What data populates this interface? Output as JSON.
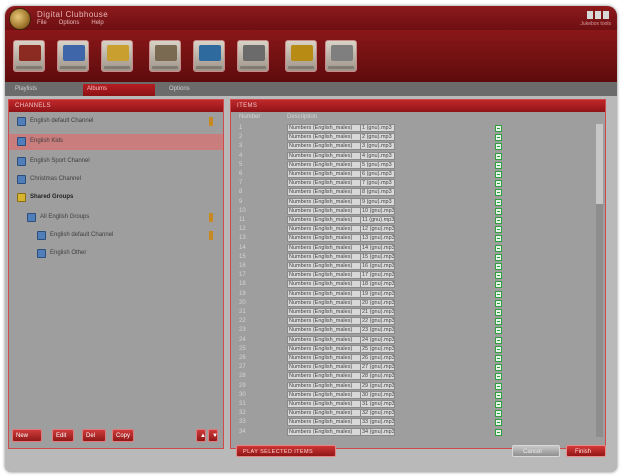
{
  "app": {
    "title": "Digital Clubhouse",
    "status": "Jukebox tools"
  },
  "menu": [
    "File",
    "Options",
    "Help"
  ],
  "toolbar": {
    "buttons": [
      {
        "name": "umbrella",
        "color": "#8c2b22"
      },
      {
        "name": "mixer",
        "color": "#3f66a8"
      },
      {
        "name": "chart",
        "color": "#c99f30"
      },
      {
        "name": "doc-edit",
        "color": "#7a6a52"
      },
      {
        "name": "globe",
        "color": "#2e6a9e"
      },
      {
        "name": "settings",
        "color": "#6b6b6b"
      },
      {
        "name": "pin",
        "color": "#b88b14"
      },
      {
        "name": "cup",
        "color": "#7f7f7f"
      }
    ]
  },
  "tabs": {
    "inactive_1": "Playlists",
    "active": "Albums",
    "inactive_2": "Options"
  },
  "left_pane": {
    "header": "CHANNELS",
    "rows": [
      {
        "label": "English default Channel",
        "flag": true,
        "bold": false,
        "indent": 0
      },
      {
        "label": "English Kids",
        "flag": false,
        "bold": false,
        "indent": 0,
        "selected": true
      },
      {
        "label": "English Sport Channel",
        "flag": false,
        "bold": false,
        "indent": 0
      },
      {
        "label": "Christmas Channel",
        "flag": false,
        "bold": false,
        "indent": 0
      },
      {
        "label": "Shared Groups",
        "flag": false,
        "bold": true,
        "indent": 0
      },
      {
        "label": "All English Groups",
        "flag": true,
        "bold": false,
        "indent": 1
      },
      {
        "label": "English default Channel",
        "flag": true,
        "bold": false,
        "indent": 2
      },
      {
        "label": "English Other",
        "flag": false,
        "bold": false,
        "indent": 2
      }
    ],
    "footer_buttons": [
      "New",
      "Edit",
      "Del",
      "Copy"
    ]
  },
  "right_pane": {
    "header": "ITEMS",
    "columns": [
      "Number",
      "Description"
    ],
    "rows": [
      {
        "num": "1",
        "name": "Numbers (English_males)",
        "ext": "1 (gnu).mp3"
      },
      {
        "num": "2",
        "name": "Numbers (English_males)",
        "ext": "2 (gnu).mp3"
      },
      {
        "num": "3",
        "name": "Numbers (English_males)",
        "ext": "3 (gnu).mp3"
      },
      {
        "num": "4",
        "name": "Numbers (English_males)",
        "ext": "4 (gnu).mp3"
      },
      {
        "num": "5",
        "name": "Numbers (English_males)",
        "ext": "5 (gnu).mp3"
      },
      {
        "num": "6",
        "name": "Numbers (English_males)",
        "ext": "6 (gnu).mp3"
      },
      {
        "num": "7",
        "name": "Numbers (English_males)",
        "ext": "7 (gnu).mp3"
      },
      {
        "num": "8",
        "name": "Numbers (English_males)",
        "ext": "8 (gnu).mp3"
      },
      {
        "num": "9",
        "name": "Numbers (English_males)",
        "ext": "9 (gnu).mp3"
      },
      {
        "num": "10",
        "name": "Numbers (English_males)",
        "ext": "10 (gnu).mp3"
      },
      {
        "num": "11",
        "name": "Numbers (English_males)",
        "ext": "11 (gnu).mp3"
      },
      {
        "num": "12",
        "name": "Numbers (English_males)",
        "ext": "12 (gnu).mp3"
      },
      {
        "num": "13",
        "name": "Numbers (English_males)",
        "ext": "13 (gnu).mp3"
      },
      {
        "num": "14",
        "name": "Numbers (English_males)",
        "ext": "14 (gnu).mp3"
      },
      {
        "num": "15",
        "name": "Numbers (English_males)",
        "ext": "15 (gnu).mp3"
      },
      {
        "num": "16",
        "name": "Numbers (English_males)",
        "ext": "16 (gnu).mp3"
      },
      {
        "num": "17",
        "name": "Numbers (English_males)",
        "ext": "17 (gnu).mp3"
      },
      {
        "num": "18",
        "name": "Numbers (English_males)",
        "ext": "18 (gnu).mp3"
      },
      {
        "num": "19",
        "name": "Numbers (English_males)",
        "ext": "19 (gnu).mp3"
      },
      {
        "num": "20",
        "name": "Numbers (English_males)",
        "ext": "20 (gnu).mp3"
      },
      {
        "num": "21",
        "name": "Numbers (English_males)",
        "ext": "21 (gnu).mp3"
      },
      {
        "num": "22",
        "name": "Numbers (English_males)",
        "ext": "22 (gnu).mp3"
      },
      {
        "num": "23",
        "name": "Numbers (English_males)",
        "ext": "23 (gnu).mp3"
      },
      {
        "num": "24",
        "name": "Numbers (English_males)",
        "ext": "24 (gnu).mp3"
      },
      {
        "num": "25",
        "name": "Numbers (English_males)",
        "ext": "25 (gnu).mp3"
      },
      {
        "num": "26",
        "name": "Numbers (English_males)",
        "ext": "26 (gnu).mp3"
      },
      {
        "num": "27",
        "name": "Numbers (English_males)",
        "ext": "27 (gnu).mp3"
      },
      {
        "num": "28",
        "name": "Numbers (English_males)",
        "ext": "28 (gnu).mp3"
      },
      {
        "num": "29",
        "name": "Numbers (English_males)",
        "ext": "29 (gnu).mp3"
      },
      {
        "num": "30",
        "name": "Numbers (English_males)",
        "ext": "30 (gnu).mp3"
      },
      {
        "num": "31",
        "name": "Numbers (English_males)",
        "ext": "31 (gnu).mp3"
      },
      {
        "num": "32",
        "name": "Numbers (English_males)",
        "ext": "32 (gnu).mp3"
      },
      {
        "num": "33",
        "name": "Numbers (English_males)",
        "ext": "33 (gnu).mp3"
      },
      {
        "num": "34",
        "name": "Numbers (English_males)",
        "ext": "34 (gnu).mp3"
      }
    ]
  },
  "actions": {
    "play": "PLAY SELECTED ITEMS",
    "cancel": "Cancel",
    "ok": "Finish"
  },
  "colors": {
    "brand": "#8c1719",
    "accent": "#c9282c",
    "panel": "#9e9e9e"
  }
}
